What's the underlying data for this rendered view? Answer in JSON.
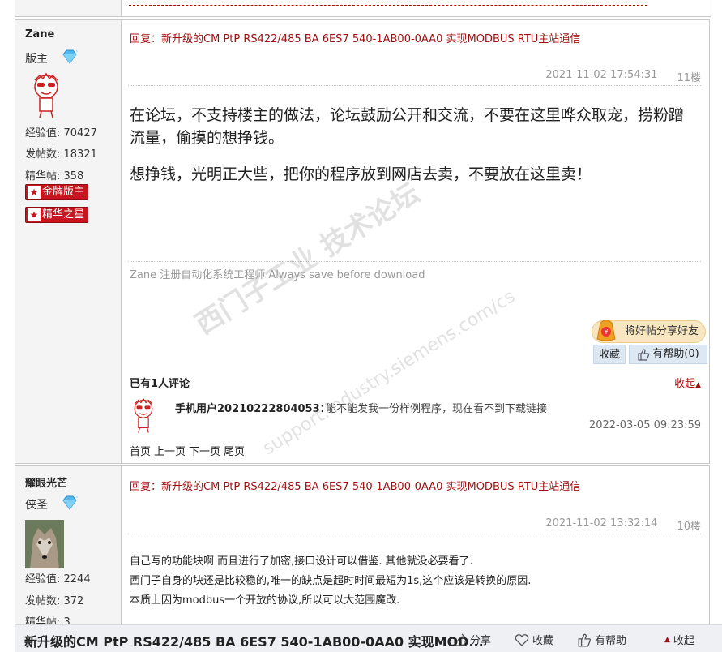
{
  "watermark": {
    "line1": "西门子工业 技术论坛",
    "line2": "support.industry.siemens.com/cs"
  },
  "post1": {
    "user": {
      "name": "Zane",
      "rank": "版主",
      "exp": "经验值: 70427",
      "posts": "发帖数: 18321",
      "essence": "精华帖: 358",
      "badges": [
        "金牌版主",
        "精华之星"
      ]
    },
    "title": "回复：新升级的CM PtP RS422/485 BA 6ES7 540-1AB00-0AA0 实现MODBUS RTU主站通信",
    "date": "2021-11-02 17:54:31",
    "floor": "11楼",
    "paragraphs": [
      "在论坛，不支持楼主的做法，论坛鼓励公开和交流，不要在这里哗众取宠，捞粉蹭流量，偷摸的想挣钱。",
      "想挣钱，光明正大些，把你的程序放到网店去卖，不要放在这里卖！"
    ],
    "signature": "Zane 注册自动化系统工程师 Always save before download",
    "share_label": "将好帖分享好友",
    "collect_label": "收藏",
    "helpful_label": "有帮助(0)",
    "comments_header": "已有1人评论",
    "collapse_label": "收起",
    "comment": {
      "user": "手机用户20210222804053：",
      "text": "能不能发我一份样例程序，现在看不到下载链接",
      "date": "2022-03-05 09:23:59"
    },
    "pager": [
      "首页",
      "上一页",
      "下一页",
      "尾页"
    ]
  },
  "post2": {
    "user": {
      "name": "耀眼光芒",
      "rank": "侠圣",
      "exp": "经验值: 2244",
      "posts": "发帖数: 372",
      "essence": "精华帖: 3"
    },
    "title": "回复：新升级的CM PtP RS422/485 BA 6ES7 540-1AB00-0AA0 实现MODBUS RTU主站通信",
    "date": "2021-11-02 13:32:14",
    "floor": "10楼",
    "lines": [
      "自己写的功能块啊 而且进行了加密,接口设计可以借鉴. 其他就没必要看了.",
      "西门子自身的块还是比较稳的,唯一的缺点是超时时间最短为1s,这个应该是转换的原因.",
      "本质上因为modbus一个开放的协议,所以可以大范围魔改."
    ]
  },
  "bottom_bar": {
    "title": "新升级的CM PtP RS422/485 BA 6ES7 540-1AB00-0AA0 实现MOD...",
    "share": "分享",
    "collect": "收藏",
    "helpful": "有帮助",
    "collapse": "收起"
  }
}
